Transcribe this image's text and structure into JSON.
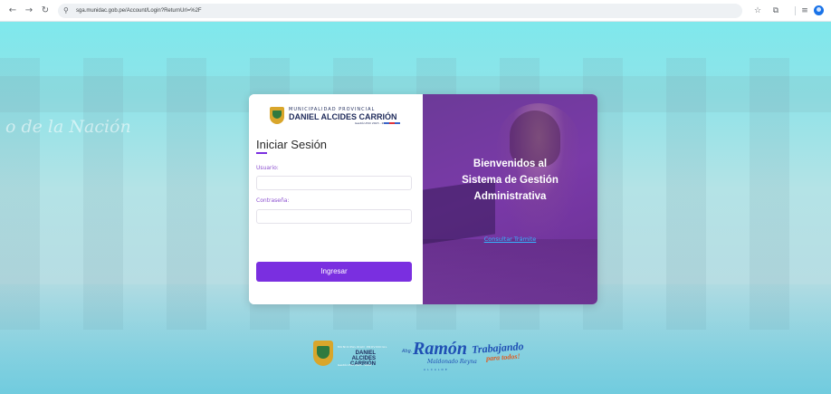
{
  "browser": {
    "url": "sga.munidac.gob.pe/Account/Login?ReturnUrl=%2F"
  },
  "background": {
    "text": "o de la Nación"
  },
  "logo": {
    "line1": "MUNICIPALIDAD PROVINCIAL",
    "line2": "DANIEL ALCIDES CARRIÓN",
    "line3": "Gestión Edil 2023 - 2026"
  },
  "login": {
    "title": "Iniciar Sesión",
    "user_label": "Usuario:",
    "user_value": "",
    "password_label": "Contraseña:",
    "password_value": "",
    "submit_label": "Ingresar"
  },
  "welcome": {
    "line1": "Bienvenidos al",
    "line2": "Sistema de Gestión",
    "line3": "Administrativa",
    "link": "Consultar Trámite"
  },
  "footer": {
    "muni_small": "MUNICIPALIDAD PROVINCIAL",
    "muni_name": "DANIEL ALCIDES CARRIÓN",
    "muni_sub": "Gestión Edil 2023 - 2026",
    "abg": "Abg.",
    "ramon": "Ramón",
    "signature": "Maldonado Reyna",
    "alcalde": "ALCALDE",
    "trabajando": "Trabajando",
    "todos": "para todos!"
  },
  "colors": {
    "accent": "#7a2fe0",
    "panel": "#6c3a98",
    "link": "#35b6ff"
  }
}
